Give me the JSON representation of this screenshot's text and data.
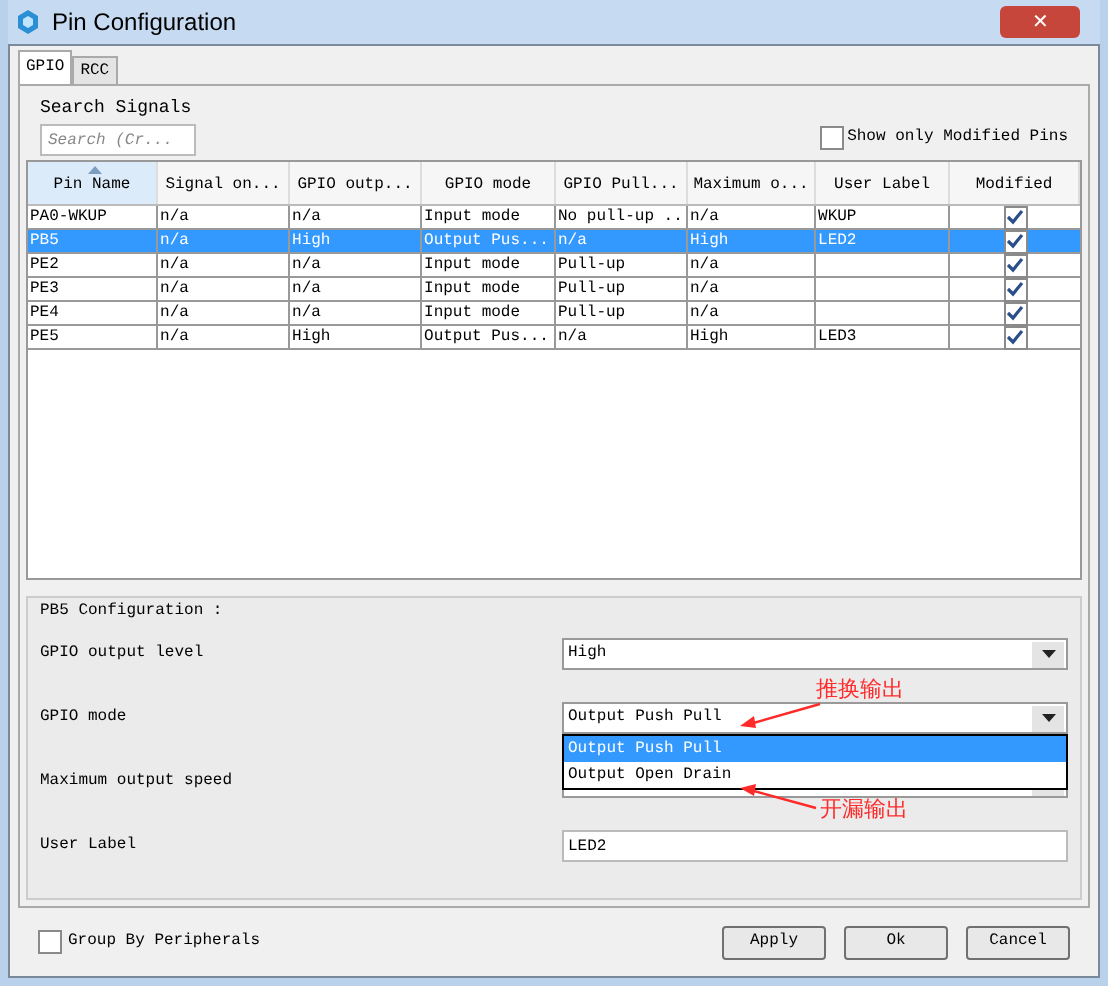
{
  "window": {
    "title": "Pin Configuration",
    "close": "✕"
  },
  "tabs": [
    {
      "label": "GPIO",
      "selected": true
    },
    {
      "label": "RCC",
      "selected": false
    }
  ],
  "search": {
    "label": "Search Signals",
    "placeholder": "Search (Cr..."
  },
  "show_modified": {
    "label": "Show only Modified Pins",
    "checked": false
  },
  "table": {
    "columns": [
      "Pin Name",
      "Signal on...",
      "GPIO outp...",
      "GPIO mode",
      "GPIO Pull...",
      "Maximum o...",
      "User Label",
      "Modified"
    ],
    "rows": [
      {
        "cells": [
          "PA0-WKUP",
          "n/a",
          "n/a",
          "Input mode",
          "No pull-up ...",
          "n/a",
          "WKUP"
        ],
        "modified": true,
        "selected": false
      },
      {
        "cells": [
          "PB5",
          "n/a",
          "High",
          "Output Pus...",
          "n/a",
          "High",
          "LED2"
        ],
        "modified": true,
        "selected": true
      },
      {
        "cells": [
          "PE2",
          "n/a",
          "n/a",
          "Input mode",
          "Pull-up",
          "n/a",
          ""
        ],
        "modified": true,
        "selected": false
      },
      {
        "cells": [
          "PE3",
          "n/a",
          "n/a",
          "Input mode",
          "Pull-up",
          "n/a",
          ""
        ],
        "modified": true,
        "selected": false
      },
      {
        "cells": [
          "PE4",
          "n/a",
          "n/a",
          "Input mode",
          "Pull-up",
          "n/a",
          ""
        ],
        "modified": true,
        "selected": false
      },
      {
        "cells": [
          "PE5",
          "n/a",
          "High",
          "Output Pus...",
          "n/a",
          "High",
          "LED3"
        ],
        "modified": true,
        "selected": false
      }
    ]
  },
  "config": {
    "title": "PB5 Configuration :",
    "fields": [
      {
        "label": "GPIO output level",
        "kind": "combo",
        "value": "High"
      },
      {
        "label": "GPIO mode",
        "kind": "combo",
        "value": "Output Push Pull",
        "expanded": true,
        "options": [
          {
            "label": "Output Push Pull",
            "selected": true
          },
          {
            "label": "Output Open Drain",
            "selected": false
          }
        ]
      },
      {
        "label": "Maximum output speed",
        "kind": "combo"
      },
      {
        "label": "User Label",
        "kind": "text",
        "value": "LED2"
      }
    ]
  },
  "annotations": [
    {
      "text": "推换输出"
    },
    {
      "text": "开漏输出"
    }
  ],
  "group_by": {
    "label": "Group By Peripherals",
    "checked": false
  },
  "buttons": [
    "Apply",
    "Ok",
    "Cancel"
  ]
}
